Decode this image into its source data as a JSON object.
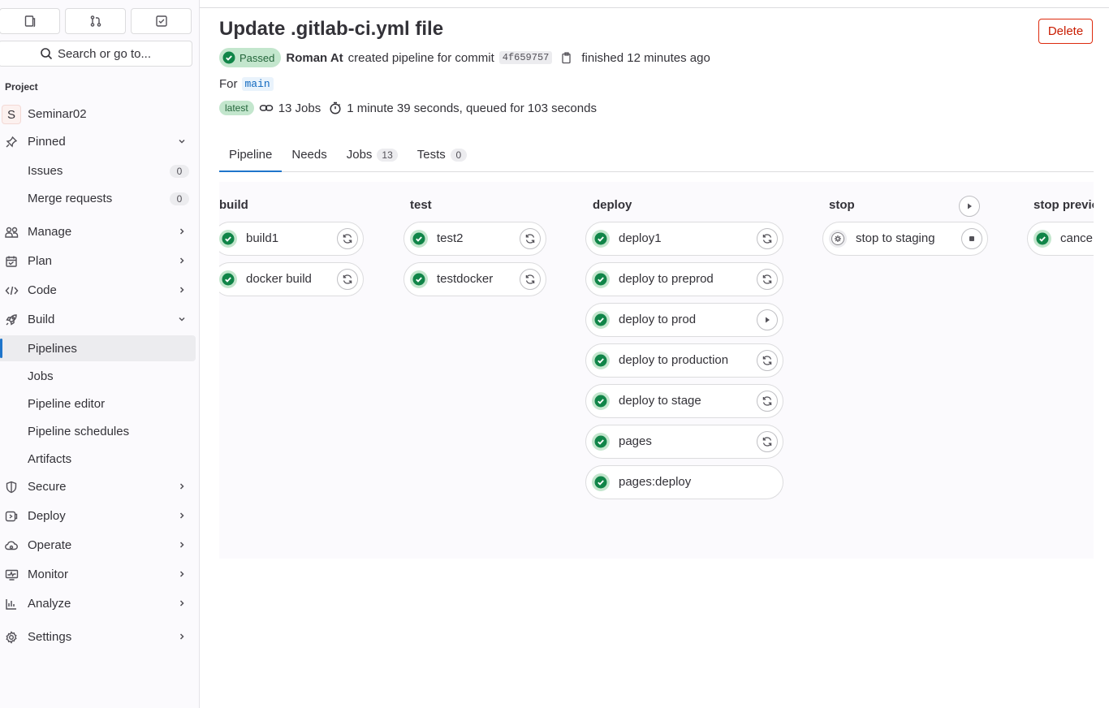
{
  "sidebar": {
    "search_label": "Search or go to...",
    "project_heading": "Project",
    "project": {
      "initial": "S",
      "name": "Seminar02"
    },
    "pinned": {
      "label": "Pinned",
      "items": [
        {
          "label": "Issues",
          "count": "0"
        },
        {
          "label": "Merge requests",
          "count": "0"
        }
      ]
    },
    "sections": [
      {
        "label": "Manage",
        "icon": "users-icon"
      },
      {
        "label": "Plan",
        "icon": "calendar-icon"
      },
      {
        "label": "Code",
        "icon": "code-icon"
      },
      {
        "label": "Build",
        "icon": "rocket-icon"
      }
    ],
    "build_items": [
      {
        "label": "Pipelines",
        "active": true
      },
      {
        "label": "Jobs"
      },
      {
        "label": "Pipeline editor"
      },
      {
        "label": "Pipeline schedules"
      },
      {
        "label": "Artifacts"
      }
    ],
    "more_sections": [
      {
        "label": "Secure",
        "icon": "shield-icon"
      },
      {
        "label": "Deploy",
        "icon": "deploy-icon"
      },
      {
        "label": "Operate",
        "icon": "cloud-icon"
      },
      {
        "label": "Monitor",
        "icon": "monitor-icon"
      },
      {
        "label": "Analyze",
        "icon": "chart-icon"
      },
      {
        "label": "Settings",
        "icon": "gear-icon"
      }
    ]
  },
  "header": {
    "title": "Update .gitlab-ci.yml file",
    "delete_label": "Delete",
    "status": "Passed",
    "author": "Roman At",
    "created_text": "created pipeline for commit",
    "commit_sha": "4f659757",
    "finished_text": "finished 12 minutes ago",
    "for_label": "For",
    "branch": "main",
    "latest_badge": "latest",
    "jobs_count": "13 Jobs",
    "duration_text": "1 minute 39 seconds, queued for 103 seconds"
  },
  "tabs": [
    {
      "label": "Pipeline",
      "active": true
    },
    {
      "label": "Needs"
    },
    {
      "label": "Jobs",
      "count": "13"
    },
    {
      "label": "Tests",
      "count": "0"
    }
  ],
  "stages": [
    {
      "name": "build",
      "jobs": [
        {
          "name": "build1",
          "action": "retry"
        },
        {
          "name": "docker build",
          "action": "retry"
        }
      ]
    },
    {
      "name": "test",
      "jobs": [
        {
          "name": "test2",
          "action": "retry"
        },
        {
          "name": "testdocker",
          "action": "retry"
        }
      ]
    },
    {
      "name": "deploy",
      "jobs": [
        {
          "name": "deploy1",
          "action": "retry"
        },
        {
          "name": "deploy to preprod",
          "action": "retry"
        },
        {
          "name": "deploy to prod",
          "action": "play"
        },
        {
          "name": "deploy to production",
          "action": "retry"
        },
        {
          "name": "deploy to stage",
          "action": "retry"
        },
        {
          "name": "pages",
          "action": "retry"
        },
        {
          "name": "pages:deploy",
          "action": "none"
        }
      ]
    },
    {
      "name": "stop",
      "jobs": [
        {
          "name": "stop to staging",
          "action": "stop",
          "status": "manual"
        }
      ]
    },
    {
      "name": "stop previous",
      "jobs": [
        {
          "name": "cancel",
          "action": "none"
        }
      ]
    }
  ],
  "colors": {
    "success": "#108548",
    "accent": "#1f75cb",
    "danger": "#dd2b0e"
  }
}
